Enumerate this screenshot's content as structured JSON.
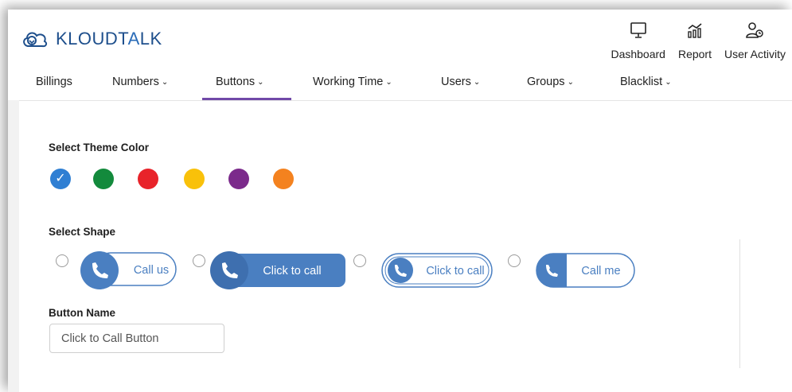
{
  "brand": {
    "logo_text_1": "KLOUDT",
    "logo_text_2": "A",
    "logo_text_3": "LK"
  },
  "top_nav": [
    {
      "label": "Dashboard",
      "icon": "monitor-icon"
    },
    {
      "label": "Report",
      "icon": "chart-icon"
    },
    {
      "label": "User Activity",
      "icon": "user-clock-icon"
    }
  ],
  "sub_nav": [
    {
      "label": "Billings",
      "has_dropdown": false
    },
    {
      "label": "Numbers",
      "has_dropdown": true
    },
    {
      "label": "Buttons",
      "has_dropdown": true,
      "active": true
    },
    {
      "label": "Working Time",
      "has_dropdown": true
    },
    {
      "label": "Users",
      "has_dropdown": true
    },
    {
      "label": "Groups",
      "has_dropdown": true
    },
    {
      "label": "Blacklist",
      "has_dropdown": true
    }
  ],
  "theme": {
    "label": "Select Theme Color",
    "colors": [
      "#2f7fd3",
      "#138a3c",
      "#e8232a",
      "#f9c10a",
      "#7b2a8b",
      "#f4821f"
    ],
    "selected_index": 0
  },
  "shape": {
    "label": "Select Shape",
    "options": [
      "Call us",
      "Click to call",
      "Click to call",
      "Call me"
    ]
  },
  "button_name": {
    "label": "Button Name",
    "value": "Click to Call Button"
  },
  "colors": {
    "accent": "#4a7fc1",
    "nav_active": "#7149a8"
  }
}
